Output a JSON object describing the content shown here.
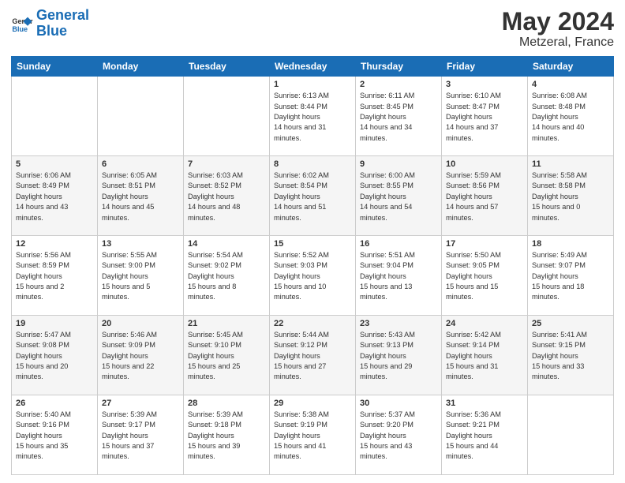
{
  "header": {
    "logo_general": "General",
    "logo_blue": "Blue",
    "month": "May 2024",
    "location": "Metzeral, France"
  },
  "weekdays": [
    "Sunday",
    "Monday",
    "Tuesday",
    "Wednesday",
    "Thursday",
    "Friday",
    "Saturday"
  ],
  "weeks": [
    [
      null,
      null,
      null,
      {
        "day": "1",
        "sunrise": "6:13 AM",
        "sunset": "8:44 PM",
        "daylight": "14 hours and 31 minutes."
      },
      {
        "day": "2",
        "sunrise": "6:11 AM",
        "sunset": "8:45 PM",
        "daylight": "14 hours and 34 minutes."
      },
      {
        "day": "3",
        "sunrise": "6:10 AM",
        "sunset": "8:47 PM",
        "daylight": "14 hours and 37 minutes."
      },
      {
        "day": "4",
        "sunrise": "6:08 AM",
        "sunset": "8:48 PM",
        "daylight": "14 hours and 40 minutes."
      }
    ],
    [
      {
        "day": "5",
        "sunrise": "6:06 AM",
        "sunset": "8:49 PM",
        "daylight": "14 hours and 43 minutes."
      },
      {
        "day": "6",
        "sunrise": "6:05 AM",
        "sunset": "8:51 PM",
        "daylight": "14 hours and 45 minutes."
      },
      {
        "day": "7",
        "sunrise": "6:03 AM",
        "sunset": "8:52 PM",
        "daylight": "14 hours and 48 minutes."
      },
      {
        "day": "8",
        "sunrise": "6:02 AM",
        "sunset": "8:54 PM",
        "daylight": "14 hours and 51 minutes."
      },
      {
        "day": "9",
        "sunrise": "6:00 AM",
        "sunset": "8:55 PM",
        "daylight": "14 hours and 54 minutes."
      },
      {
        "day": "10",
        "sunrise": "5:59 AM",
        "sunset": "8:56 PM",
        "daylight": "14 hours and 57 minutes."
      },
      {
        "day": "11",
        "sunrise": "5:58 AM",
        "sunset": "8:58 PM",
        "daylight": "15 hours and 0 minutes."
      }
    ],
    [
      {
        "day": "12",
        "sunrise": "5:56 AM",
        "sunset": "8:59 PM",
        "daylight": "15 hours and 2 minutes."
      },
      {
        "day": "13",
        "sunrise": "5:55 AM",
        "sunset": "9:00 PM",
        "daylight": "15 hours and 5 minutes."
      },
      {
        "day": "14",
        "sunrise": "5:54 AM",
        "sunset": "9:02 PM",
        "daylight": "15 hours and 8 minutes."
      },
      {
        "day": "15",
        "sunrise": "5:52 AM",
        "sunset": "9:03 PM",
        "daylight": "15 hours and 10 minutes."
      },
      {
        "day": "16",
        "sunrise": "5:51 AM",
        "sunset": "9:04 PM",
        "daylight": "15 hours and 13 minutes."
      },
      {
        "day": "17",
        "sunrise": "5:50 AM",
        "sunset": "9:05 PM",
        "daylight": "15 hours and 15 minutes."
      },
      {
        "day": "18",
        "sunrise": "5:49 AM",
        "sunset": "9:07 PM",
        "daylight": "15 hours and 18 minutes."
      }
    ],
    [
      {
        "day": "19",
        "sunrise": "5:47 AM",
        "sunset": "9:08 PM",
        "daylight": "15 hours and 20 minutes."
      },
      {
        "day": "20",
        "sunrise": "5:46 AM",
        "sunset": "9:09 PM",
        "daylight": "15 hours and 22 minutes."
      },
      {
        "day": "21",
        "sunrise": "5:45 AM",
        "sunset": "9:10 PM",
        "daylight": "15 hours and 25 minutes."
      },
      {
        "day": "22",
        "sunrise": "5:44 AM",
        "sunset": "9:12 PM",
        "daylight": "15 hours and 27 minutes."
      },
      {
        "day": "23",
        "sunrise": "5:43 AM",
        "sunset": "9:13 PM",
        "daylight": "15 hours and 29 minutes."
      },
      {
        "day": "24",
        "sunrise": "5:42 AM",
        "sunset": "9:14 PM",
        "daylight": "15 hours and 31 minutes."
      },
      {
        "day": "25",
        "sunrise": "5:41 AM",
        "sunset": "9:15 PM",
        "daylight": "15 hours and 33 minutes."
      }
    ],
    [
      {
        "day": "26",
        "sunrise": "5:40 AM",
        "sunset": "9:16 PM",
        "daylight": "15 hours and 35 minutes."
      },
      {
        "day": "27",
        "sunrise": "5:39 AM",
        "sunset": "9:17 PM",
        "daylight": "15 hours and 37 minutes."
      },
      {
        "day": "28",
        "sunrise": "5:39 AM",
        "sunset": "9:18 PM",
        "daylight": "15 hours and 39 minutes."
      },
      {
        "day": "29",
        "sunrise": "5:38 AM",
        "sunset": "9:19 PM",
        "daylight": "15 hours and 41 minutes."
      },
      {
        "day": "30",
        "sunrise": "5:37 AM",
        "sunset": "9:20 PM",
        "daylight": "15 hours and 43 minutes."
      },
      {
        "day": "31",
        "sunrise": "5:36 AM",
        "sunset": "9:21 PM",
        "daylight": "15 hours and 44 minutes."
      },
      null
    ]
  ]
}
